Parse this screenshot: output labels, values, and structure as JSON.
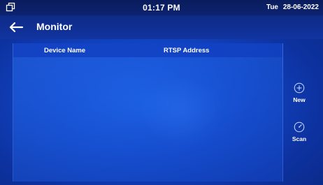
{
  "status_bar": {
    "time": "01:17 PM",
    "day": "Tue",
    "date": "28-06-2022",
    "window_icon": "window-restore-icon"
  },
  "header": {
    "back_icon": "arrow-left-icon",
    "title": "Monitor"
  },
  "table": {
    "columns": [
      "Device Name",
      "RTSP Address"
    ],
    "rows": []
  },
  "side_actions": [
    {
      "label": "New",
      "icon": "plus-circle-icon"
    },
    {
      "label": "Scan",
      "icon": "scan-circle-icon"
    }
  ],
  "colors": {
    "background": "#1247c8",
    "status_bar": "#0a1c5c",
    "title_bar": "#0e2a86",
    "text": "#ffffff"
  }
}
